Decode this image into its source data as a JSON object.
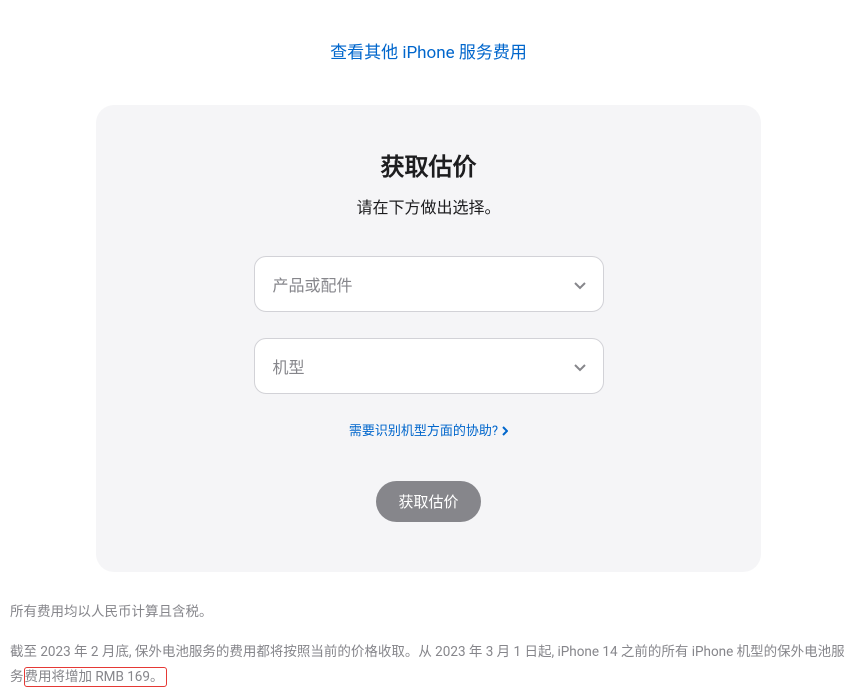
{
  "top_link": {
    "label": "查看其他 iPhone 服务费用"
  },
  "card": {
    "title": "获取估价",
    "subtitle": "请在下方做出选择。",
    "select1": {
      "placeholder": "产品或配件"
    },
    "select2": {
      "placeholder": "机型"
    },
    "help_link": "需要识别机型方面的协助?",
    "submit_label": "获取估价"
  },
  "footer": {
    "line1": "所有费用均以人民币计算且含税。",
    "line2_part1": "截至 2023 年 2 月底, 保外电池服务的费用都将按照当前的价格收取。从 2023 年 3 月 1 日起, iPhone 14 之前的所有 iPhone 机型的保外电池服务",
    "line2_highlight": "费用将增加 RMB 169。"
  }
}
